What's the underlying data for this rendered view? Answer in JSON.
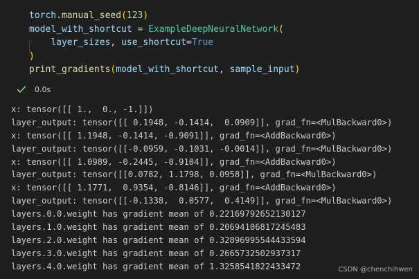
{
  "code_cell": {
    "lines": [
      [
        {
          "t": "torch",
          "c": "t-var"
        },
        {
          "t": ".",
          "c": "t-op"
        },
        {
          "t": "manual_seed",
          "c": "t-fn"
        },
        {
          "t": "(",
          "c": "t-br"
        },
        {
          "t": "123",
          "c": "t-num"
        },
        {
          "t": ")",
          "c": "t-br"
        }
      ],
      [
        {
          "t": "model_with_shortcut",
          "c": "t-var"
        },
        {
          "t": " = ",
          "c": "t-op"
        },
        {
          "t": "ExampleDeepNeuralNetwork",
          "c": "t-cls"
        },
        {
          "t": "(",
          "c": "t-br"
        }
      ],
      [
        {
          "t": "    ",
          "c": "t-op"
        },
        {
          "t": "layer_sizes",
          "c": "t-var"
        },
        {
          "t": ", ",
          "c": "t-op"
        },
        {
          "t": "use_shortcut",
          "c": "t-var"
        },
        {
          "t": "=",
          "c": "t-op"
        },
        {
          "t": "True",
          "c": "t-kw"
        }
      ],
      [
        {
          "t": ")",
          "c": "t-br"
        }
      ],
      [
        {
          "t": "print_gradients",
          "c": "t-fn"
        },
        {
          "t": "(",
          "c": "t-br"
        },
        {
          "t": "model_with_shortcut",
          "c": "t-var"
        },
        {
          "t": ", ",
          "c": "t-op"
        },
        {
          "t": "sample_input",
          "c": "t-var"
        },
        {
          "t": ")",
          "c": "t-br"
        }
      ]
    ],
    "status": {
      "icon": "check-icon",
      "time": "0.0s",
      "success_color": "#89d185"
    }
  },
  "output": {
    "lines": [
      "x: tensor([[ 1.,  0., -1.]])",
      "layer_output: tensor([[ 0.1948, -0.1414,  0.0909]], grad_fn=<MulBackward0>)",
      "x: tensor([[ 1.1948, -0.1414, -0.9091]], grad_fn=<AddBackward0>)",
      "layer_output: tensor([[-0.0959, -0.1031, -0.0014]], grad_fn=<MulBackward0>)",
      "x: tensor([[ 1.0989, -0.2445, -0.9104]], grad_fn=<AddBackward0>)",
      "layer_output: tensor([[0.0782, 1.1798, 0.0958]], grad_fn=<MulBackward0>)",
      "x: tensor([[ 1.1771,  0.9354, -0.8146]], grad_fn=<AddBackward0>)",
      "layer_output: tensor([[-0.1338,  0.0577,  0.4149]], grad_fn=<MulBackward0>)",
      "layers.0.0.weight has gradient mean of 0.22169792652130127",
      "layers.1.0.weight has gradient mean of 0.20694106817245483",
      "layers.2.0.weight has gradient mean of 0.32896995544433594",
      "layers.3.0.weight has gradient mean of 0.2665732502937317",
      "layers.4.0.weight has gradient mean of 1.3258541822433472"
    ]
  },
  "watermark": "CSDN @chenchihwen"
}
